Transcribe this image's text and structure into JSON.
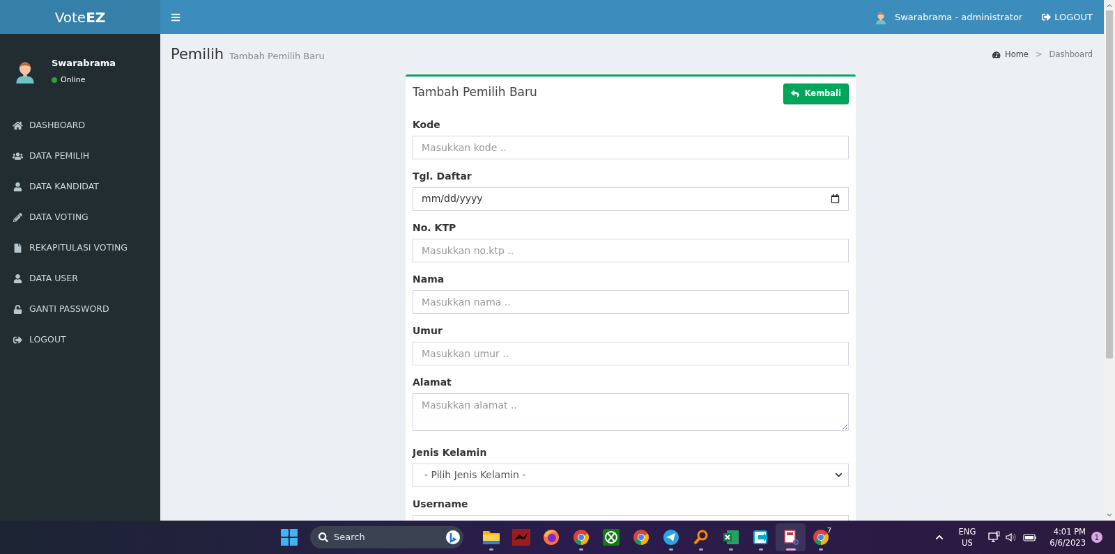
{
  "brand": {
    "light": "Vote",
    "bold": "EZ"
  },
  "user_panel": {
    "name": "Swarabrama",
    "status": "Online",
    "online": true
  },
  "sidebar": {
    "items": [
      {
        "label": "DASHBOARD",
        "kind": "home"
      },
      {
        "label": "DATA PEMILIH",
        "kind": "users"
      },
      {
        "label": "DATA KANDIDAT",
        "kind": "user"
      },
      {
        "label": "DATA VOTING",
        "kind": "pencil"
      },
      {
        "label": "REKAPITULASI VOTING",
        "kind": "file"
      },
      {
        "label": "DATA USER",
        "kind": "user"
      },
      {
        "label": "GANTI PASSWORD",
        "kind": "unlock"
      },
      {
        "label": "LOGOUT",
        "kind": "logout"
      }
    ]
  },
  "navbar": {
    "user": "Swarabrama - administrator",
    "logout": "LOGOUT"
  },
  "page": {
    "title": "Pemilih",
    "subtitle": "Tambah Pemilih Baru",
    "breadcrumb": [
      "Home",
      "Dashboard"
    ],
    "breadcrumb_separator": ">"
  },
  "card": {
    "title": "Tambah Pemilih Baru",
    "back_button": "Kembali",
    "fields": [
      {
        "label": "Kode",
        "kind": "input",
        "placeholder": "Masukkan kode .."
      },
      {
        "label": "Tgl. Daftar",
        "kind": "date",
        "placeholder": "mm/dd/yyyy"
      },
      {
        "label": "No. KTP",
        "kind": "input",
        "placeholder": "Masukkan no.ktp .."
      },
      {
        "label": "Nama",
        "kind": "input",
        "placeholder": "Masukkan nama .."
      },
      {
        "label": "Umur",
        "kind": "input",
        "placeholder": "Masukkan umur .."
      },
      {
        "label": "Alamat",
        "kind": "textarea",
        "placeholder": "Masukkan alamat .."
      },
      {
        "label": "Jenis Kelamin",
        "kind": "select",
        "value": "- Pilih Jenis Kelamin -"
      },
      {
        "label": "Username",
        "kind": "input"
      }
    ]
  },
  "taskbar": {
    "search": "Search",
    "apps": [
      {
        "kind": "folder",
        "running": true,
        "active": false
      },
      {
        "kind": "dragon",
        "running": false,
        "active": false
      },
      {
        "kind": "firefox",
        "running": false,
        "active": false
      },
      {
        "kind": "chrome",
        "running": true,
        "active": false
      },
      {
        "kind": "xbox",
        "running": false,
        "active": false
      },
      {
        "kind": "chrome",
        "running": false,
        "active": false
      },
      {
        "kind": "telegram",
        "running": true,
        "active": false
      },
      {
        "kind": "magnifier",
        "running": true,
        "active": false
      },
      {
        "kind": "excel",
        "running": true,
        "active": false
      },
      {
        "kind": "arrow",
        "running": true,
        "active": false
      },
      {
        "kind": "snip",
        "running": true,
        "active": true
      },
      {
        "kind": "chrome",
        "running": true,
        "active": false,
        "badge": "7"
      }
    ],
    "language": "ENG",
    "region": "US",
    "time": "4:01 PM",
    "date": "6/6/2023",
    "notifications": "1"
  }
}
